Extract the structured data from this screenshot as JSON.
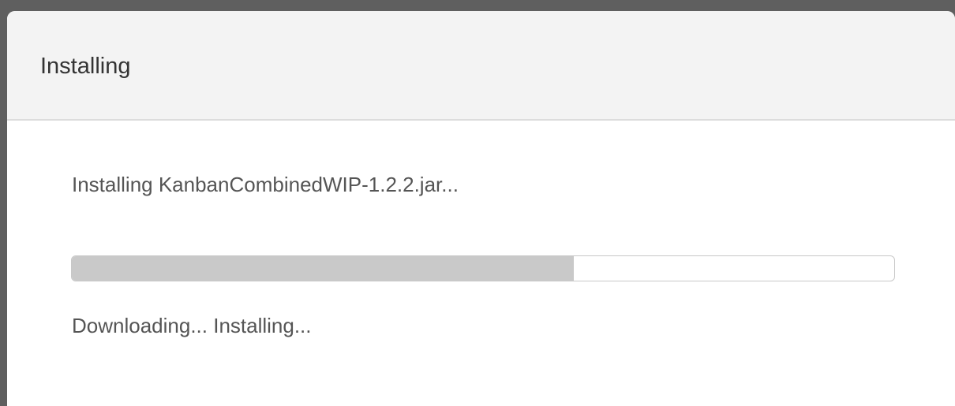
{
  "dialog": {
    "title": "Installing",
    "message": "Installing KanbanCombinedWIP-1.2.2.jar...",
    "progress_fraction": 0.61,
    "status": "Downloading... Installing..."
  },
  "colors": {
    "backdrop": "#5f5f5f",
    "header_bg": "#f3f3f3",
    "progress_fill": "#c9c9c9",
    "text": "#555555"
  }
}
